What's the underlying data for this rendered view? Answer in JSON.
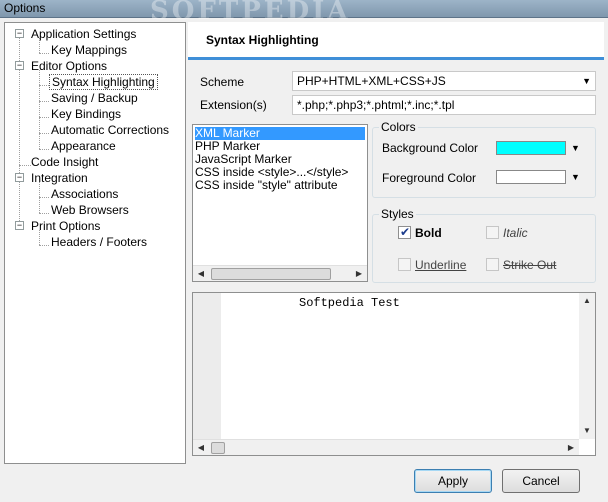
{
  "window": {
    "title": "Options",
    "watermark": "SOFTPEDIA"
  },
  "tree": {
    "items": [
      {
        "label": "Application Settings"
      },
      {
        "label": "Key Mappings"
      },
      {
        "label": "Editor Options"
      },
      {
        "label": "Syntax Highlighting"
      },
      {
        "label": "Saving / Backup"
      },
      {
        "label": "Key Bindings"
      },
      {
        "label": "Automatic Corrections"
      },
      {
        "label": "Appearance"
      },
      {
        "label": "Code Insight"
      },
      {
        "label": "Integration"
      },
      {
        "label": "Associations"
      },
      {
        "label": "Web Browsers"
      },
      {
        "label": "Print Options"
      },
      {
        "label": "Headers / Footers"
      }
    ],
    "expander_symbol": "−"
  },
  "panel": {
    "title": "Syntax Highlighting"
  },
  "scheme": {
    "label": "Scheme",
    "value": "PHP+HTML+XML+CSS+JS"
  },
  "extensions": {
    "label": "Extension(s)",
    "value": "*.php;*.php3;*.phtml;*.inc;*.tpl"
  },
  "markers": {
    "items": [
      "XML Marker",
      "PHP Marker",
      "JavaScript Marker",
      "CSS inside <style>...</style>",
      "CSS inside \"style\" attribute"
    ]
  },
  "colors": {
    "legend": "Colors",
    "background_label": "Background Color",
    "background_color": "#00ffff",
    "foreground_label": "Foreground Color",
    "foreground_color": "#ffffff"
  },
  "styles": {
    "legend": "Styles",
    "bold": {
      "label": "Bold",
      "checked": true
    },
    "italic": {
      "label": "Italic",
      "checked": false
    },
    "underline": {
      "label": "Underline",
      "checked": false
    },
    "strikeout": {
      "label": "Strike Out",
      "checked": false
    }
  },
  "preview": {
    "text": "Softpedia Test"
  },
  "buttons": {
    "apply": "Apply",
    "cancel": "Cancel"
  },
  "icons": {
    "dropdown": "▼",
    "left": "◀",
    "right": "▶",
    "up": "▲",
    "down": "▼"
  }
}
